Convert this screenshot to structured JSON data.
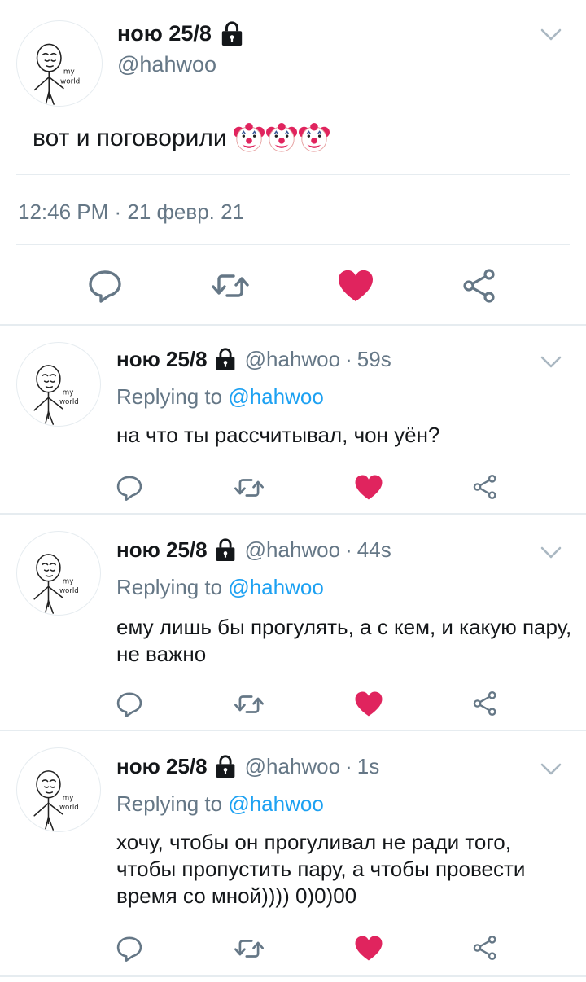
{
  "main_tweet": {
    "name": "ною 25/8",
    "handle": "@hahwoo",
    "text": "вот и поговорили",
    "emoji": "clown-face x3",
    "timestamp": "12:46 PM · 21 февр. 21",
    "liked": true
  },
  "avatar": {
    "caption_line1": "my",
    "caption_line2": "world"
  },
  "replies": [
    {
      "name": "ною 25/8",
      "handle": "@hahwoo",
      "dot": "·",
      "time": "59s",
      "replying_prefix": "Replying to",
      "replying_to": "@hahwoo",
      "text": "на что ты рассчитывал, чон уён?",
      "liked": true
    },
    {
      "name": "ною 25/8",
      "handle": "@hahwoo",
      "dot": "·",
      "time": "44s",
      "replying_prefix": "Replying to",
      "replying_to": "@hahwoo",
      "text": "ему лишь бы прогулять, а с кем, и какую пару, не важно",
      "liked": true
    },
    {
      "name": "ною 25/8",
      "handle": "@hahwoo",
      "dot": "·",
      "time": "1s",
      "replying_prefix": "Replying to",
      "replying_to": "@hahwoo",
      "text": "хочу, чтобы он прогуливал не ради того, чтобы пропустить пару, а чтобы провести время со мной)))) 0)0)00",
      "liked": true
    }
  ],
  "colors": {
    "like": "#e0245e",
    "icon": "#657786",
    "link": "#1da1f2",
    "divider": "#e6ecf0"
  },
  "icons": [
    "lock-icon",
    "chevron-down-icon",
    "reply-icon",
    "retweet-icon",
    "heart-icon",
    "share-icon",
    "clown-emoji"
  ]
}
